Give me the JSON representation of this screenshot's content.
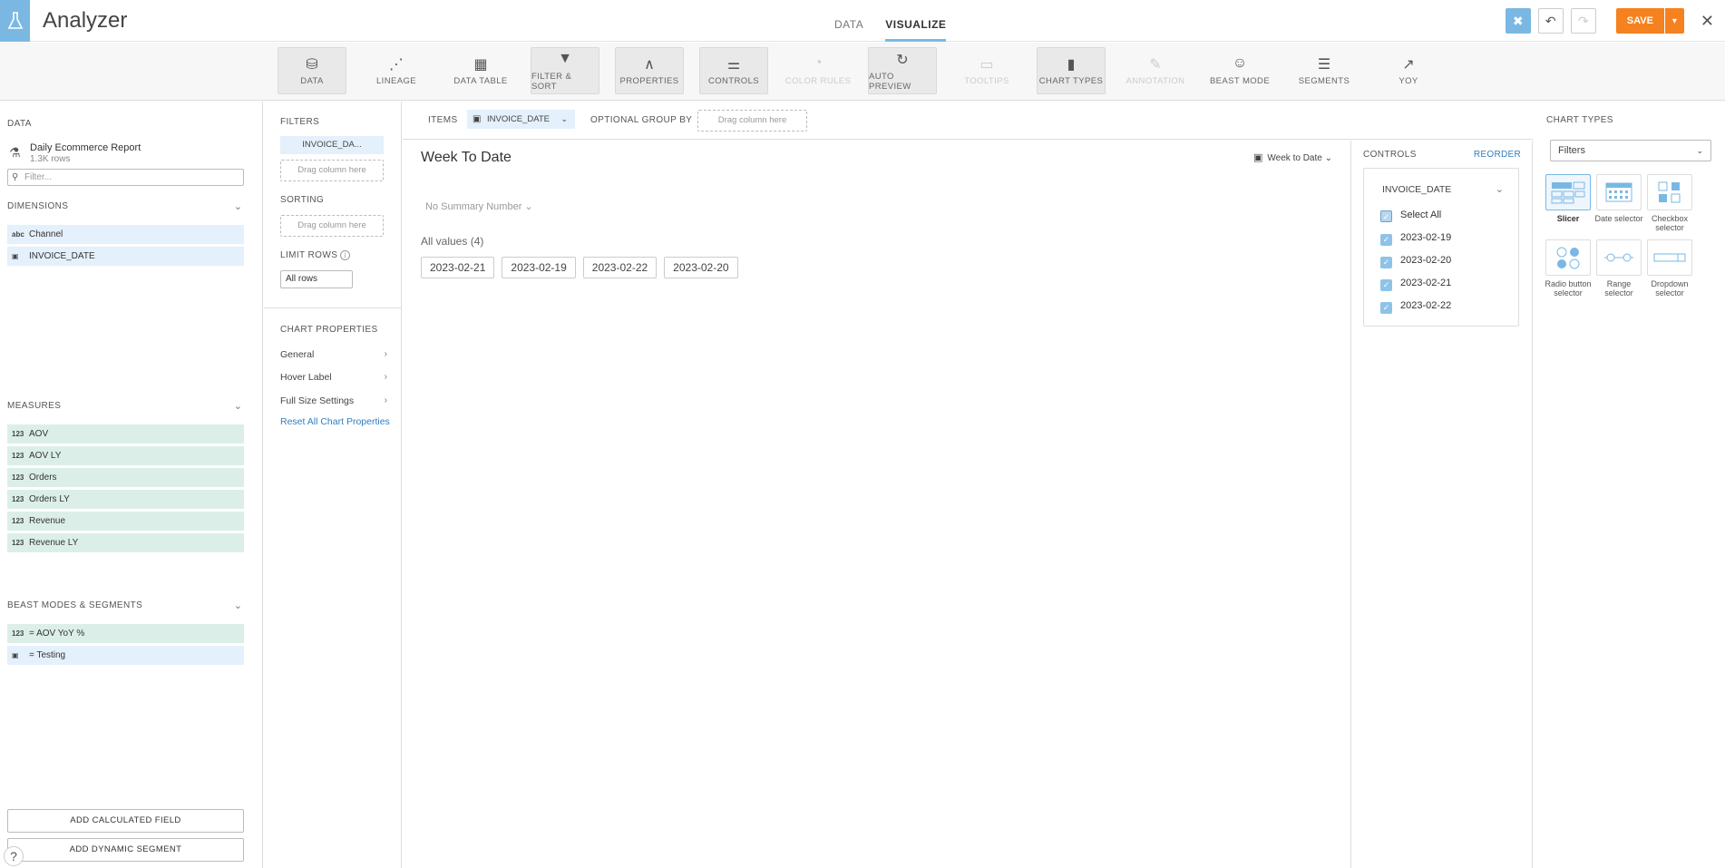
{
  "app": {
    "title": "Analyzer"
  },
  "top_tabs": [
    {
      "label": "DATA"
    },
    {
      "label": "VISUALIZE"
    }
  ],
  "top_actions": {
    "save_label": "SAVE"
  },
  "toolbar": [
    {
      "label": "DATA",
      "icon": "database-icon",
      "glyph": "⛁"
    },
    {
      "label": "LINEAGE",
      "icon": "lineage-icon",
      "glyph": "⋰"
    },
    {
      "label": "DATA TABLE",
      "icon": "table-icon",
      "glyph": "▦"
    },
    {
      "label": "FILTER & SORT",
      "icon": "filter-icon",
      "glyph": "▼"
    },
    {
      "label": "PROPERTIES",
      "icon": "compass-icon",
      "glyph": "∧"
    },
    {
      "label": "CONTROLS",
      "icon": "sliders-icon",
      "glyph": "⚌"
    },
    {
      "label": "COLOR RULES",
      "icon": "palette-icon",
      "glyph": "◔"
    },
    {
      "label": "AUTO PREVIEW",
      "icon": "refresh-icon",
      "glyph": "↻"
    },
    {
      "label": "TOOLTIPS",
      "icon": "tooltip-icon",
      "glyph": "▭"
    },
    {
      "label": "CHART TYPES",
      "icon": "bar-chart-icon",
      "glyph": "▮"
    },
    {
      "label": "ANNOTATION",
      "icon": "pencil-icon",
      "glyph": "✎"
    },
    {
      "label": "BEAST MODE",
      "icon": "beast-icon",
      "glyph": "☺"
    },
    {
      "label": "SEGMENTS",
      "icon": "segments-icon",
      "glyph": "☰"
    },
    {
      "label": "YOY",
      "icon": "yoy-icon",
      "glyph": "↗"
    }
  ],
  "data_panel": {
    "section_label": "DATA",
    "dataset_name": "Daily Ecommerce Report",
    "dataset_rows": "1.3K rows",
    "filter_placeholder": "Filter...",
    "dimensions_label": "DIMENSIONS",
    "dimensions": [
      {
        "label": "Channel",
        "icon_text": "abc"
      },
      {
        "label": "INVOICE_DATE",
        "icon_text": "▣"
      }
    ],
    "measures_label": "MEASURES",
    "measures": [
      {
        "label": "AOV",
        "icon_text": "123"
      },
      {
        "label": "AOV LY",
        "icon_text": "123"
      },
      {
        "label": "Orders",
        "icon_text": "123"
      },
      {
        "label": "Orders LY",
        "icon_text": "123"
      },
      {
        "label": "Revenue",
        "icon_text": "123"
      },
      {
        "label": "Revenue LY",
        "icon_text": "123"
      }
    ],
    "beast_label": "BEAST MODES & SEGMENTS",
    "beast_items": [
      {
        "label": "= AOV YoY %",
        "icon_text": "123"
      },
      {
        "label": "= Testing",
        "icon_text": "▣"
      }
    ],
    "add_calc_label": "ADD CALCULATED FIELD",
    "add_segment_label": "ADD DYNAMIC SEGMENT",
    "help_label": "?"
  },
  "filters_panel": {
    "filters_label": "FILTERS",
    "filter_pill": "INVOICE_DA...",
    "drag_label": "Drag column here",
    "sorting_label": "SORTING",
    "limit_label": "LIMIT ROWS",
    "limit_value": "All rows",
    "chart_props_label": "CHART PROPERTIES",
    "props": [
      {
        "label": "General"
      },
      {
        "label": "Hover Label"
      },
      {
        "label": "Full Size Settings"
      }
    ],
    "reset_label": "Reset All Chart Properties"
  },
  "items_bar": {
    "items_label": "ITEMS",
    "item_pill": "INVOICE_DATE",
    "group_label": "OPTIONAL GROUP BY",
    "drag_label": "Drag column here"
  },
  "canvas": {
    "title": "Week To Date",
    "period": "Week to Date",
    "summary": "No Summary Number",
    "all_values": "All values (4)",
    "chips": [
      "2023-02-21",
      "2023-02-19",
      "2023-02-22",
      "2023-02-20"
    ]
  },
  "controls": {
    "label": "CONTROLS",
    "reorder_label": "REORDER",
    "box_title": "INVOICE_DATE",
    "select_all": "Select All",
    "options": [
      "2023-02-19",
      "2023-02-20",
      "2023-02-21",
      "2023-02-22"
    ]
  },
  "chart_types": {
    "label": "CHART TYPES",
    "selected": "Filters",
    "tiles": [
      {
        "label": "Slicer",
        "icon": "slicer-icon"
      },
      {
        "label": "Date selector",
        "icon": "calendar-icon"
      },
      {
        "label": "Checkbox selector",
        "icon": "checkbox-icon"
      },
      {
        "label": "Radio button selector",
        "icon": "radio-icon"
      },
      {
        "label": "Range selector",
        "icon": "range-icon"
      },
      {
        "label": "Dropdown selector",
        "icon": "dropdown-icon"
      }
    ]
  },
  "colors": {
    "accent": "#7ab8e3",
    "save": "#f5821f",
    "dimension_bg": "#e4f0fb",
    "measure_bg": "#dbefe8",
    "link": "#2f7fc1"
  }
}
